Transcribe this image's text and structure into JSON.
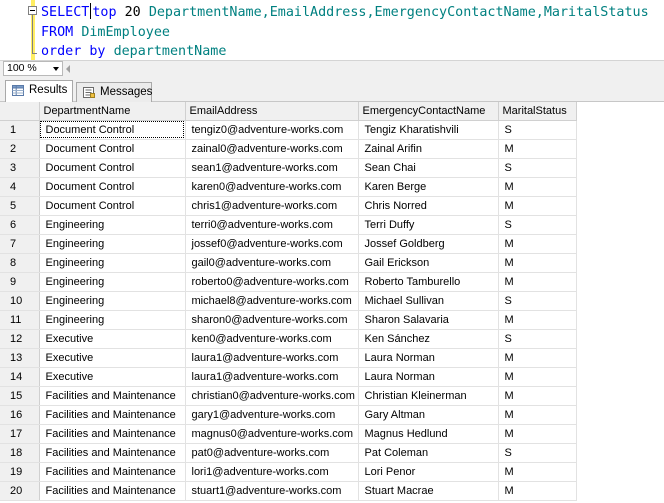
{
  "editor": {
    "query_tokens": {
      "select": "SELECT",
      "top": "top",
      "count": "20",
      "columns": "DepartmentName,EmailAddress,EmergencyContactName,MaritalStatus",
      "from": "FROM",
      "table": "DimEmployee",
      "order_by": "order by",
      "order_column": "departmentName"
    }
  },
  "zoom": {
    "value": "100 %"
  },
  "tabs": [
    {
      "label": "Results",
      "active": true,
      "icon": "grid-icon"
    },
    {
      "label": "Messages",
      "active": false,
      "icon": "messages-icon"
    }
  ],
  "results": {
    "columns": [
      "DepartmentName",
      "EmailAddress",
      "EmergencyContactName",
      "MaritalStatus"
    ],
    "rows": [
      [
        "1",
        "Document Control",
        "tengiz0@adventure-works.com",
        "Tengiz Kharatishvili",
        "S"
      ],
      [
        "2",
        "Document Control",
        "zainal0@adventure-works.com",
        "Zainal Arifin",
        "M"
      ],
      [
        "3",
        "Document Control",
        "sean1@adventure-works.com",
        "Sean Chai",
        "S"
      ],
      [
        "4",
        "Document Control",
        "karen0@adventure-works.com",
        "Karen Berge",
        "M"
      ],
      [
        "5",
        "Document Control",
        "chris1@adventure-works.com",
        "Chris Norred",
        "M"
      ],
      [
        "6",
        "Engineering",
        "terri0@adventure-works.com",
        "Terri Duffy",
        "S"
      ],
      [
        "7",
        "Engineering",
        "jossef0@adventure-works.com",
        "Jossef Goldberg",
        "M"
      ],
      [
        "8",
        "Engineering",
        "gail0@adventure-works.com",
        "Gail Erickson",
        "M"
      ],
      [
        "9",
        "Engineering",
        "roberto0@adventure-works.com",
        "Roberto Tamburello",
        "M"
      ],
      [
        "10",
        "Engineering",
        "michael8@adventure-works.com",
        "Michael Sullivan",
        "S"
      ],
      [
        "11",
        "Engineering",
        "sharon0@adventure-works.com",
        "Sharon Salavaria",
        "M"
      ],
      [
        "12",
        "Executive",
        "ken0@adventure-works.com",
        "Ken Sánchez",
        "S"
      ],
      [
        "13",
        "Executive",
        "laura1@adventure-works.com",
        "Laura Norman",
        "M"
      ],
      [
        "14",
        "Executive",
        "laura1@adventure-works.com",
        "Laura Norman",
        "M"
      ],
      [
        "15",
        "Facilities and Maintenance",
        "christian0@adventure-works.com",
        "Christian Kleinerman",
        "M"
      ],
      [
        "16",
        "Facilities and Maintenance",
        "gary1@adventure-works.com",
        "Gary Altman",
        "M"
      ],
      [
        "17",
        "Facilities and Maintenance",
        "magnus0@adventure-works.com",
        "Magnus Hedlund",
        "M"
      ],
      [
        "18",
        "Facilities and Maintenance",
        "pat0@adventure-works.com",
        "Pat Coleman",
        "S"
      ],
      [
        "19",
        "Facilities and Maintenance",
        "lori1@adventure-works.com",
        "Lori Penor",
        "M"
      ],
      [
        "20",
        "Facilities and Maintenance",
        "stuart1@adventure-works.com",
        "Stuart Macrae",
        "M"
      ]
    ]
  }
}
